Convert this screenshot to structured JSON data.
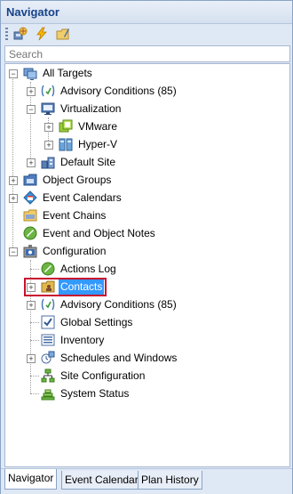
{
  "panel": {
    "title": "Navigator"
  },
  "toolbar": {
    "icons": [
      "target-wizard-icon",
      "lightning-icon",
      "folder-edit-icon"
    ]
  },
  "search": {
    "placeholder": "Search",
    "value": ""
  },
  "tree": {
    "items": [
      {
        "label": "All Targets"
      },
      {
        "label": "Advisory Conditions (85)"
      },
      {
        "label": "Virtualization"
      },
      {
        "label": "VMware"
      },
      {
        "label": "Hyper-V"
      },
      {
        "label": "Default Site"
      },
      {
        "label": "Object Groups"
      },
      {
        "label": "Event Calendars"
      },
      {
        "label": "Event Chains"
      },
      {
        "label": "Event and Object Notes"
      },
      {
        "label": "Configuration"
      },
      {
        "label": "Actions Log"
      },
      {
        "label": "Contacts",
        "selected": true
      },
      {
        "label": "Advisory Conditions (85)"
      },
      {
        "label": "Global Settings"
      },
      {
        "label": "Inventory"
      },
      {
        "label": "Schedules and Windows"
      },
      {
        "label": "Site Configuration"
      },
      {
        "label": "System Status"
      }
    ]
  },
  "tabs": [
    {
      "label": "Navigator",
      "active": true
    },
    {
      "label": "Event Calendar"
    },
    {
      "label": "Plan History"
    }
  ],
  "colors": {
    "selection": "#3399ff",
    "highlight_border": "#c8102e",
    "title_text": "#15428b"
  }
}
